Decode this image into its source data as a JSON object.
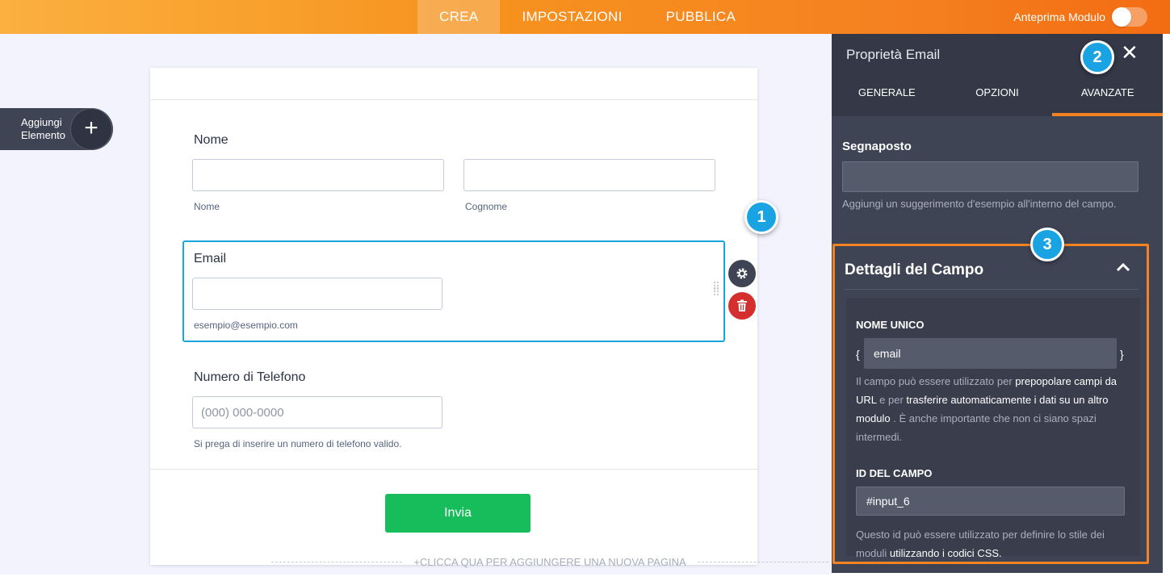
{
  "topbar": {
    "tabs": [
      {
        "label": "CREA",
        "active": true
      },
      {
        "label": "IMPOSTAZIONI",
        "active": false
      },
      {
        "label": "PUBBLICA",
        "active": false
      }
    ],
    "preview_label": "Anteprima Modulo",
    "preview_on": false
  },
  "canvas": {
    "add_element_line1": "Aggiungi",
    "add_element_line2": "Elemento",
    "add_page": "+CLICCA QUA PER AGGIUNGERE UNA NUOVA PAGINA"
  },
  "form": {
    "name_label": "Nome",
    "first_sublabel": "Nome",
    "last_sublabel": "Cognome",
    "email_label": "Email",
    "email_sublabel": "esempio@esempio.com",
    "phone_label": "Numero di Telefono",
    "phone_placeholder": "(000) 000-0000",
    "phone_sublabel": "Si prega di inserire un numero di telefono valido.",
    "submit_label": "Invia"
  },
  "panel": {
    "title": "Proprietà Email",
    "tabs": [
      {
        "label": "GENERALE",
        "active": false
      },
      {
        "label": "OPZIONI",
        "active": false
      },
      {
        "label": "AVANZATE",
        "active": true
      }
    ],
    "placeholder_label": "Segnaposto",
    "placeholder_value": "",
    "placeholder_help": "Aggiungi un suggerimento d'esempio all'interno del campo.",
    "details_title": "Dettagli del Campo",
    "unique_name_label": "NOME UNICO",
    "unique_name_value": "email",
    "unique_help_1": "Il campo può essere utilizzato per",
    "unique_help_hl1": "prepopolare campi da URL",
    "unique_help_2": "e per",
    "unique_help_hl2": "trasferire automaticamente i dati su un altro modulo",
    "unique_help_3": ". È anche importante che non ci siano spazi intermedi.",
    "field_id_label": "ID DEL CAMPO",
    "field_id_value": "#input_6",
    "field_id_help_1": "Questo id può essere utilizzato per definire lo stile dei moduli",
    "field_id_help_hl": "utilizzando i codici CSS."
  },
  "callouts": [
    "1",
    "2",
    "3"
  ],
  "colors": {
    "accent": "#f58220",
    "panel": "#3f4454",
    "focus": "#18a7d8",
    "submit": "#18bd5b",
    "delete": "#d42e2e",
    "callout": "#1aa3e3"
  },
  "icons": [
    "plus-icon",
    "gear-icon",
    "trash-icon",
    "close-icon",
    "chevron-up-icon",
    "drag-handle-icon"
  ]
}
